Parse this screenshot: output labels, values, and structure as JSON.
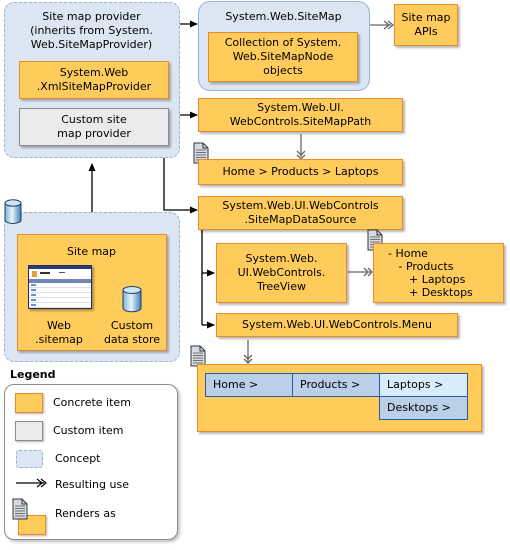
{
  "provider": {
    "title": "Site map provider\n(inherits from System.\nWeb.SiteMapProvider)",
    "xml_provider": "System.Web\n.XmlSiteMapProvider",
    "custom_provider": "Custom site\nmap provider"
  },
  "sitemap_class": {
    "title": "System.Web.SiteMap",
    "collection": "Collection of System.\nWeb.SiteMapNode\nobjects"
  },
  "sitemap_apis": "Site map\nAPIs",
  "sitemappath": {
    "label": "System.Web.UI.\nWebControls.SiteMapPath",
    "renders": "Home > Products > Laptops"
  },
  "datasource": {
    "label": "System.Web.UI.WebControls\n.SiteMapDataSource"
  },
  "treeview": {
    "label": "System.Web.\nUI.WebControls.\nTreeView",
    "renders": "- Home\n   - Products\n      + Laptops\n      + Desktops"
  },
  "menu": {
    "label": "System.Web.UI.WebControls.Menu",
    "items": [
      "Home >",
      "Products >",
      "Laptops >",
      "Desktops >"
    ]
  },
  "site_map": {
    "title": "Site map",
    "web_sitemap": "Web\n.sitemap",
    "custom_store": "Custom\ndata store"
  },
  "legend": {
    "title": "Legend",
    "items": [
      {
        "icon": "concrete-swatch",
        "label": "Concrete item"
      },
      {
        "icon": "custom-swatch",
        "label": "Custom item"
      },
      {
        "icon": "concept-swatch",
        "label": "Concept"
      },
      {
        "icon": "double-arrow",
        "label": "Resulting use"
      },
      {
        "icon": "document-renders",
        "label": "Renders as"
      }
    ]
  },
  "colors": {
    "concrete_fill": "#ffcc5c",
    "concrete_border": "#e88b2e",
    "custom_fill": "#ebebeb",
    "concept_fill": "#dbe6f2",
    "concept_border": "#97b3d8",
    "menu_fill": "#b9d0e8",
    "menu_highlight": "#d9ecfc",
    "menu_border": "#2e5aa0"
  }
}
